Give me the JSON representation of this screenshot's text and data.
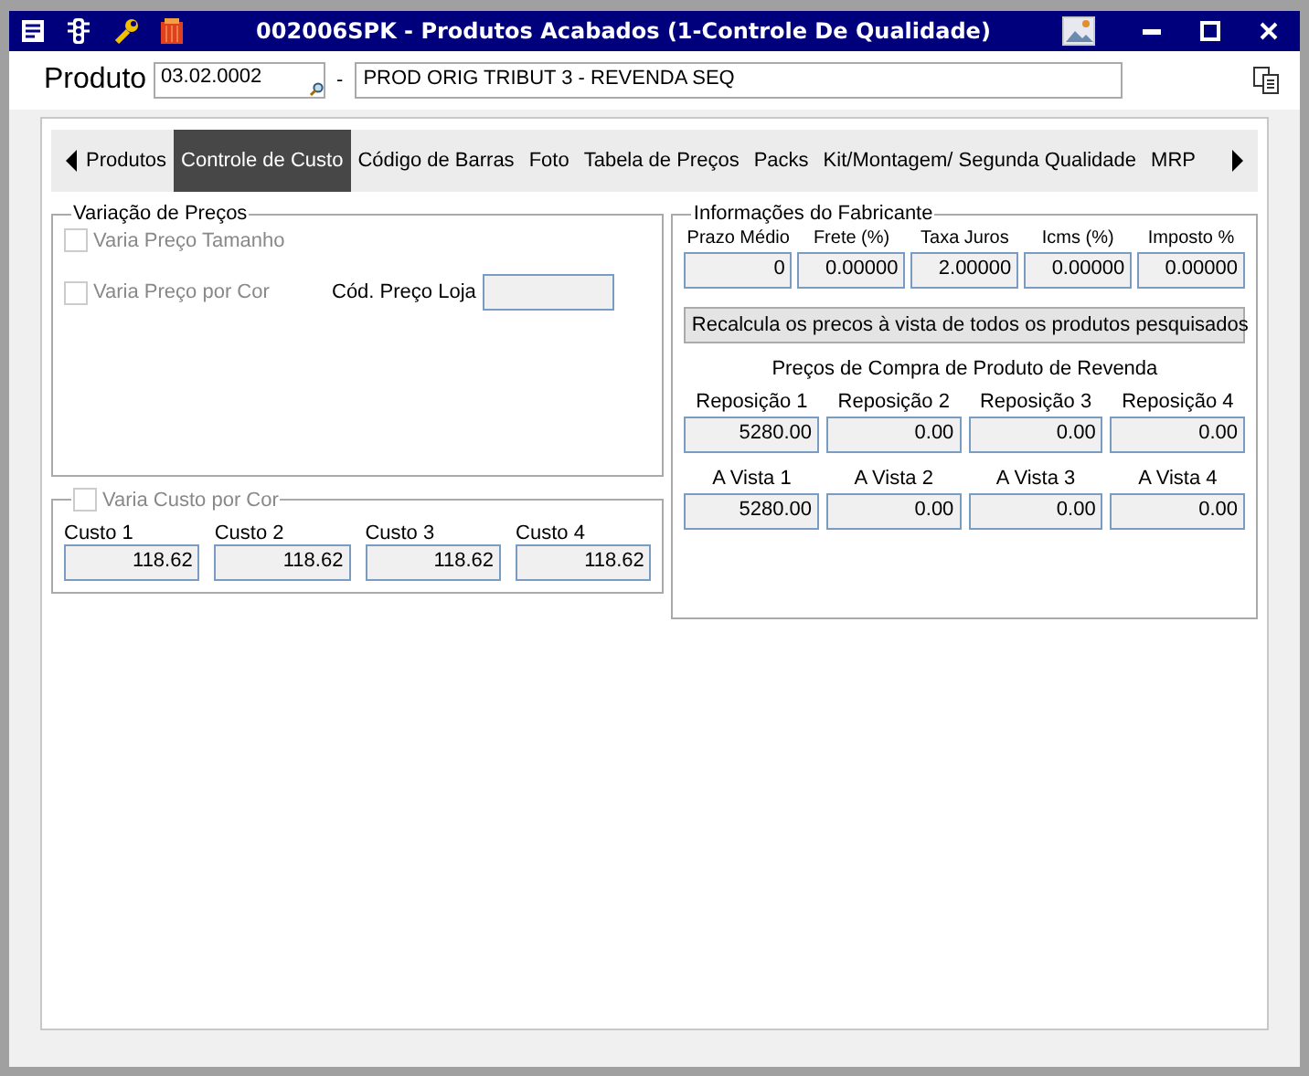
{
  "window": {
    "title": "002006SPK - Produtos Acabados (1-Controle De Qualidade)"
  },
  "product": {
    "label": "Produto",
    "code": "03.02.0002",
    "separator": "-",
    "description": "PROD ORIG TRIBUT 3 - REVENDA SEQ"
  },
  "tabs": [
    {
      "label": "Produtos",
      "selected": false
    },
    {
      "label": "Controle de Custo",
      "selected": true
    },
    {
      "label": "Código de Barras",
      "selected": false
    },
    {
      "label": "Foto",
      "selected": false
    },
    {
      "label": "Tabela de Preços",
      "selected": false
    },
    {
      "label": "Packs",
      "selected": false
    },
    {
      "label": "Kit/Montagem/ Segunda Qualidade",
      "selected": false
    },
    {
      "label": "MRP",
      "selected": false
    }
  ],
  "price_variation": {
    "title": "Variação de Preços",
    "size_check": {
      "label": "Varia Preço Tamanho",
      "checked": false,
      "disabled": true
    },
    "color_check": {
      "label": "Varia Preço por Cor",
      "checked": false,
      "disabled": true
    },
    "store_code": {
      "label": "Cód. Preço Loja"
    }
  },
  "cost_variation": {
    "check": {
      "label": "Varia Custo por Cor",
      "checked": false,
      "disabled": true
    },
    "costs": [
      {
        "label": "Custo 1",
        "value": "118.62"
      },
      {
        "label": "Custo 2",
        "value": "118.62"
      },
      {
        "label": "Custo 3",
        "value": "118.62"
      },
      {
        "label": "Custo 4",
        "value": "118.62"
      }
    ]
  },
  "manufacturer": {
    "title": "Informações do Fabricante",
    "fields": [
      {
        "label": "Prazo Médio",
        "value": "0"
      },
      {
        "label": "Frete (%)",
        "value": "0.00000"
      },
      {
        "label": "Taxa Juros",
        "value": "2.00000"
      },
      {
        "label": "Icms (%)",
        "value": "0.00000"
      },
      {
        "label": "Imposto %",
        "value": "0.00000"
      }
    ],
    "recalc_button": "Recalcula os precos à vista de todos os produtos pesquisados",
    "subtitle": "Preços de Compra de Produto de Revenda",
    "replacement": [
      {
        "label": "Reposição 1",
        "value": "5280.00"
      },
      {
        "label": "Reposição 2",
        "value": "0.00"
      },
      {
        "label": "Reposição 3",
        "value": "0.00"
      },
      {
        "label": "Reposição 4",
        "value": "0.00"
      }
    ],
    "cash": [
      {
        "label": "A Vista 1",
        "value": "5280.00"
      },
      {
        "label": "A Vista 2",
        "value": "0.00"
      },
      {
        "label": "A Vista 3",
        "value": "0.00"
      },
      {
        "label": "A Vista 4",
        "value": "0.00"
      }
    ]
  }
}
